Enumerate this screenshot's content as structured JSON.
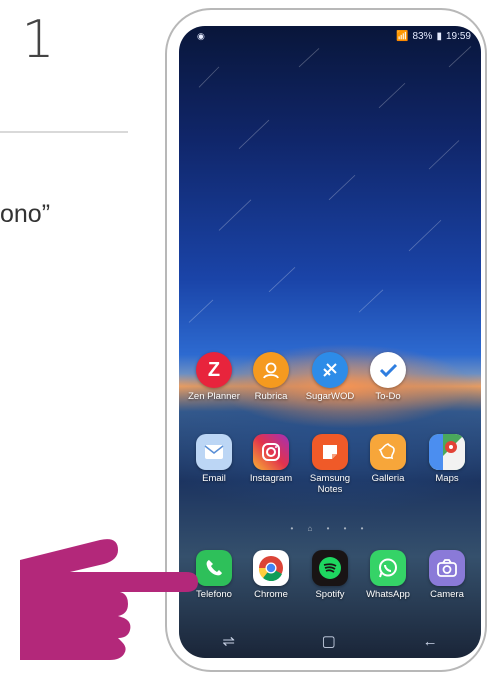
{
  "step": {
    "number": "1"
  },
  "instruction": {
    "text": "ono”"
  },
  "status_bar": {
    "battery": "83%",
    "time": "19:59"
  },
  "home_rows": [
    [
      {
        "label": "Zen Planner",
        "icon": "zen-planner-icon",
        "color": "#e8243c"
      },
      {
        "label": "Rubrica",
        "icon": "contacts-icon",
        "color": "#f59a1f"
      },
      {
        "label": "SugarWOD",
        "icon": "sugarwod-icon",
        "color": "#2d8ce8"
      },
      {
        "label": "To-Do",
        "icon": "todo-icon",
        "color": "#ffffff"
      }
    ],
    [
      {
        "label": "Email",
        "icon": "email-icon",
        "color": "#bcd6f5"
      },
      {
        "label": "Instagram",
        "icon": "instagram-icon",
        "color": "#c2308a"
      },
      {
        "label": "Samsung Notes",
        "icon": "samsung-notes-icon",
        "color": "#f05a28"
      },
      {
        "label": "Galleria",
        "icon": "gallery-icon",
        "color": "#f7a63a"
      },
      {
        "label": "Maps",
        "icon": "maps-icon",
        "color": "#ffffff"
      }
    ]
  ],
  "dock": [
    {
      "label": "Telefono",
      "icon": "phone-icon",
      "color": "#2ec05a"
    },
    {
      "label": "Chrome",
      "icon": "chrome-icon",
      "color": "#ffffff"
    },
    {
      "label": "Spotify",
      "icon": "spotify-icon",
      "color": "#191414"
    },
    {
      "label": "WhatsApp",
      "icon": "whatsapp-icon",
      "color": "#35d367"
    },
    {
      "label": "Camera",
      "icon": "camera-icon",
      "color": "#8a7ad8"
    }
  ],
  "colors": {
    "hand": "#b3287a"
  }
}
